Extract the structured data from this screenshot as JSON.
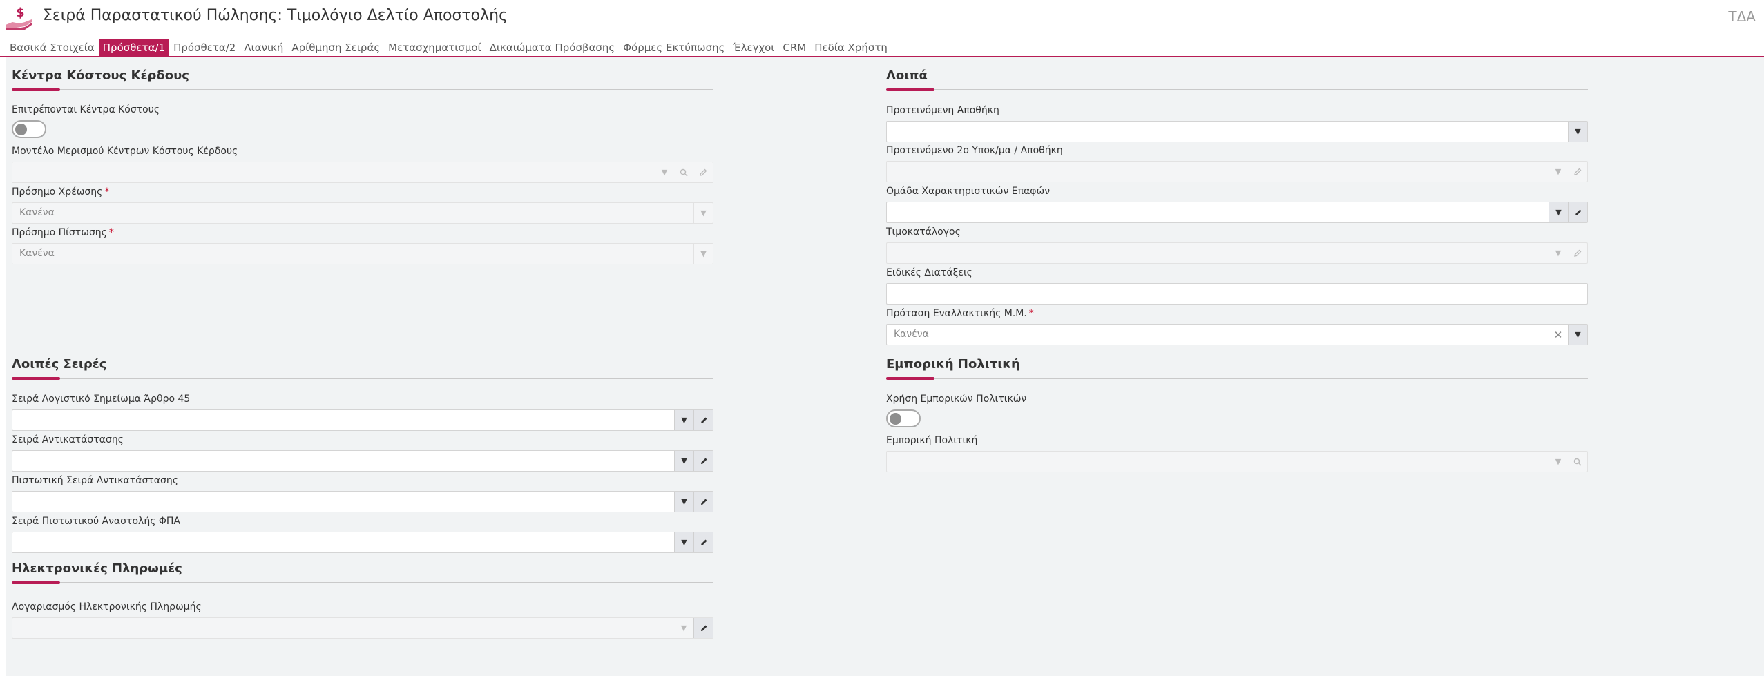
{
  "header": {
    "title": "Σειρά Παραστατικού Πώλησης: Τιμολόγιο Δελτίο Αποστολής",
    "corner": "ΤΔΑ",
    "icon": "money-hand-icon",
    "accent": "#b81c55"
  },
  "tabs": [
    {
      "label": "Βασικά Στοιχεία"
    },
    {
      "label": "Πρόσθετα/1"
    },
    {
      "label": "Πρόσθετα/2"
    },
    {
      "label": "Λιανική"
    },
    {
      "label": "Αρίθμηση Σειράς"
    },
    {
      "label": "Μετασχηματισμοί"
    },
    {
      "label": "Δικαιώματα Πρόσβασης"
    },
    {
      "label": "Φόρμες Εκτύπωσης"
    },
    {
      "label": "Έλεγχοι"
    },
    {
      "label": "CRM"
    },
    {
      "label": "Πεδία Χρήστη"
    }
  ],
  "active_tab": "Πρόσθετα/1",
  "sections": {
    "cost_centers": {
      "title": "Κέντρα Κόστους Κέρδους",
      "allow_label": "Επιτρέπονται Κέντρα Κόστους",
      "model_label": "Μοντέλο Μερισμού Κέντρων Κόστους Κέρδους",
      "debit_label": "Πρόσημο Χρέωσης",
      "debit_value": "Κανένα",
      "credit_label": "Πρόσημο Πίστωσης",
      "credit_value": "Κανένα"
    },
    "other": {
      "title": "Λοιπά",
      "warehouse_label": "Προτεινόμενη Αποθήκη",
      "branch_label": "Προτεινόμενο 2ο Υποκ/μα / Αποθήκη",
      "contact_group_label": "Ομάδα Χαρακτηριστικών Επαφών",
      "pricelist_label": "Τιμοκατάλογος",
      "special_label": "Ειδικές Διατάξεις",
      "alt_unit_label": "Πρόταση Εναλλακτικής Μ.Μ.",
      "alt_unit_value": "Κανένα"
    },
    "other_series": {
      "title": "Λοιπές Σειρές",
      "art45_label": "Σειρά Λογιστικό Σημείωμα Άρθρο 45",
      "replace_label": "Σειρά Αντικατάστασης",
      "credit_replace_label": "Πιστωτική Σειρά Αντικατάστασης",
      "vat_label": "Σειρά Πιστωτικού Αναστολής ΦΠΑ"
    },
    "commercial": {
      "title": "Εμπορική Πολιτική",
      "use_label": "Χρήση Εμπορικών Πολιτικών",
      "policy_label": "Εμπορική Πολιτική"
    },
    "epay": {
      "title": "Ηλεκτρονικές Πληρωμές",
      "account_label": "Λογαριασμός Ηλεκτρονικής Πληρωμής"
    }
  }
}
